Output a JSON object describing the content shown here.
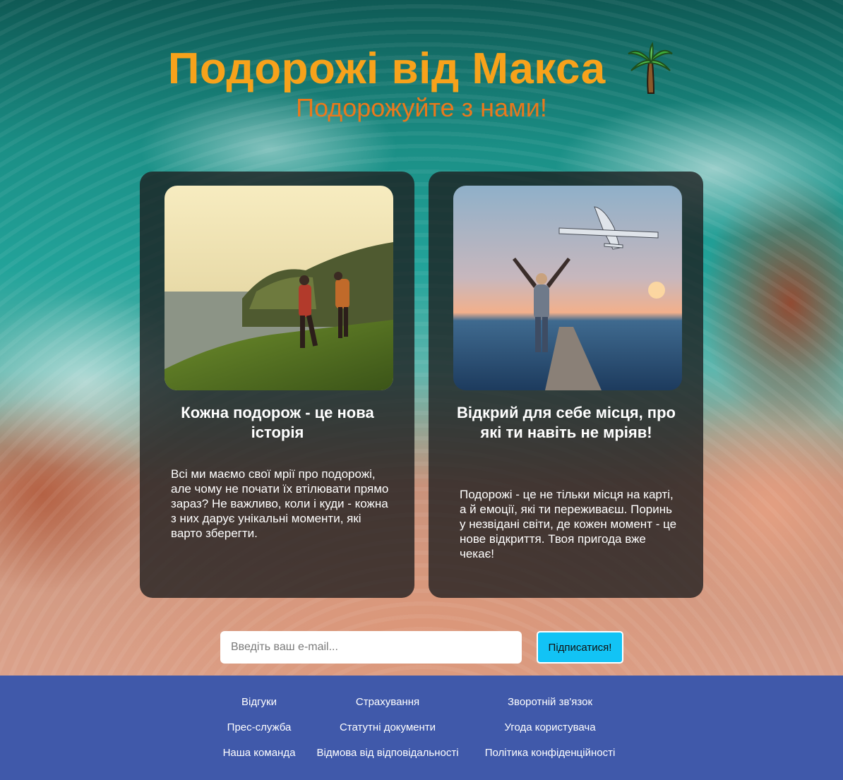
{
  "header": {
    "title": "Подорожі від Макса",
    "title_icon": "palm-tree-icon",
    "subtitle": "Подорожуйте з нами!",
    "title_color": "#f7a21b",
    "subtitle_color": "#e9791c"
  },
  "cards": [
    {
      "image": "hikers-on-coastal-cliff",
      "title": "Кожна подорож - це нова історія",
      "text": "Всі ми маємо свої мрії про подорожі, але чому не почати їх втілювати прямо зараз? Не важливо, коли і куди - кожна з них дарує унікальні моменти, які варто зберегти."
    },
    {
      "image": "traveler-watching-airplane-at-sunset",
      "title": "Відкрий для себе місця, про які ти навіть не мріяв!",
      "text": "Подорожі - це не тільки місця на карті, а й емоції, які ти переживаєш. Поринь у незвідані світи, де кожен момент - це нове відкриття. Твоя пригода вже чекає!"
    }
  ],
  "subscribe": {
    "placeholder": "Введіть ваш e-mail...",
    "value": "",
    "button_label": "Підписатися!",
    "button_color": "#12c3f5"
  },
  "footer": {
    "background": "#4059aa",
    "links": [
      "Відгуки",
      "Страхування",
      "Зворотній зв'язок",
      "Прес-служба",
      "Статутні документи",
      "Угода користувача",
      "Наша команда",
      "Відмова від відповідальності",
      "Політика конфіденційності"
    ]
  }
}
